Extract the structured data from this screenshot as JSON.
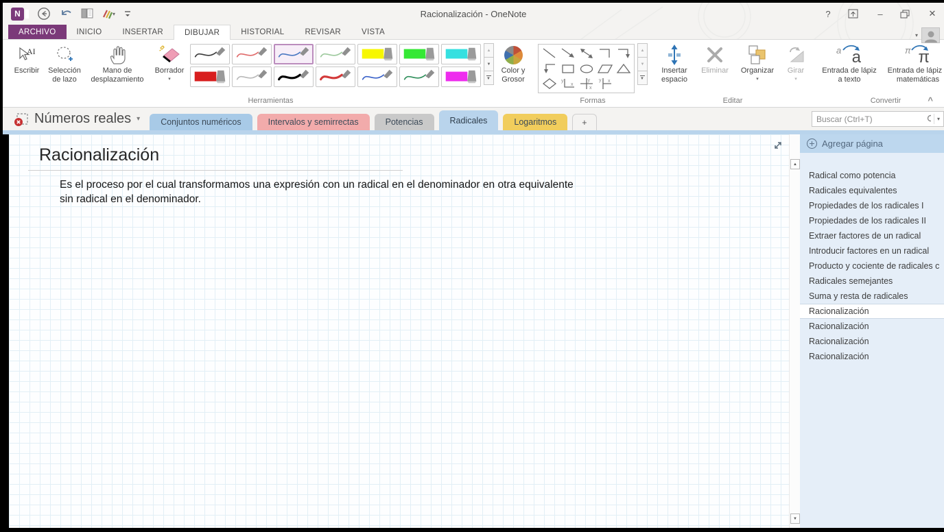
{
  "window": {
    "title": "Racionalización - OneNote"
  },
  "icons": {
    "help": "?",
    "minimize": "–",
    "close": "✕",
    "dropdown": "▾",
    "up": "▲",
    "down": "▼",
    "collapse": "^",
    "ink_text_small": "a",
    "ink_text_big": "a",
    "ink_math_small": "π",
    "ink_math_big": "π"
  },
  "ribbon_tabs": {
    "file": "ARCHIVO",
    "items": [
      "INICIO",
      "INSERTAR",
      "DIBUJAR",
      "HISTORIAL",
      "REVISAR",
      "VISTA"
    ],
    "active": "DIBUJAR"
  },
  "ribbon": {
    "herramientas": {
      "label": "Herramientas",
      "escribir": "Escribir",
      "seleccion_lazo": "Selección de lazo",
      "mano": "Mano de desplazamiento",
      "borrador": "Borrador",
      "color_grosor": "Color y Grosor"
    },
    "formas": {
      "label": "Formas"
    },
    "editar": {
      "label": "Editar",
      "insertar_espacio": "Insertar espacio",
      "eliminar": "Eliminar",
      "organizar": "Organizar",
      "girar": "Girar"
    },
    "convertir": {
      "label": "Convertir",
      "lapiz_texto": "Entrada de lápiz a texto",
      "lapiz_mat": "Entrada de lápiz a matemáticas"
    }
  },
  "pen_gallery": {
    "selected_index": 2,
    "pens": [
      {
        "kind": "pen",
        "color": "#3b3b3b",
        "thick": false
      },
      {
        "kind": "pen",
        "color": "#e06b6b",
        "thick": false
      },
      {
        "kind": "pen",
        "color": "#4a78c2",
        "thick": false
      },
      {
        "kind": "pen",
        "color": "#9dc99d",
        "thick": false
      },
      {
        "kind": "highlighter",
        "color": "#f7f700"
      },
      {
        "kind": "highlighter",
        "color": "#35e835"
      },
      {
        "kind": "highlighter",
        "color": "#35e0e0"
      },
      {
        "kind": "highlighter",
        "color": "#d81e1e"
      },
      {
        "kind": "pen",
        "color": "#b9b9b9",
        "thick": false
      },
      {
        "kind": "pen",
        "color": "#000000",
        "thick": true
      },
      {
        "kind": "pen",
        "color": "#d33a3a",
        "thick": true
      },
      {
        "kind": "pen",
        "color": "#3a62c9",
        "thick": false
      },
      {
        "kind": "pen",
        "color": "#2f8f5b",
        "thick": false
      },
      {
        "kind": "highlighter",
        "color": "#ee2cee"
      }
    ]
  },
  "color_wheel": [
    "#c05038",
    "#de8a3a",
    "#c8a43c",
    "#8fae4a",
    "#3f6fae",
    "#8a8a8a"
  ],
  "notebook": {
    "name": "Números reales"
  },
  "section_tabs": [
    {
      "label": "Conjuntos numéricos",
      "color": "#a8cae7",
      "active": false
    },
    {
      "label": "Intervalos y semirrectas",
      "color": "#f2abab",
      "active": false
    },
    {
      "label": "Potencias",
      "color": "#c9c9c9",
      "active": false
    },
    {
      "label": "Radicales",
      "color": "#b9d4ec",
      "active": true
    },
    {
      "label": "Logaritmos",
      "color": "#f1cd5c",
      "active": false
    },
    {
      "label": "+",
      "color": "#fcfcfc",
      "active": false
    }
  ],
  "search": {
    "placeholder": "Buscar (Ctrl+T)"
  },
  "page": {
    "title": "Racionalización",
    "body": "Es el proceso por el cual transformamos una expresión con un radical en el denominador en otra equivalente sin radical en el denominador."
  },
  "sidebar": {
    "add_page": "Agregar página",
    "selected_index": 9,
    "pages": [
      "Radical como potencia",
      "Radicales equivalentes",
      "Propiedades de los radicales I",
      "Propiedades de los radicales II",
      "Extraer factores de un radical",
      "Introducir factores en un radical",
      "Producto y cociente de radicales c",
      "Radicales semejantes",
      "Suma y resta de radicales",
      "Racionalización",
      "Racionalización",
      "Racionalización",
      "Racionalización"
    ]
  },
  "colors": {
    "accent_purple": "#7b3a7b",
    "tab_strip_blue": "#b9d4ec",
    "sidebar_bg": "#e5eef8",
    "sidebar_header_bg": "#bdd7ee"
  }
}
